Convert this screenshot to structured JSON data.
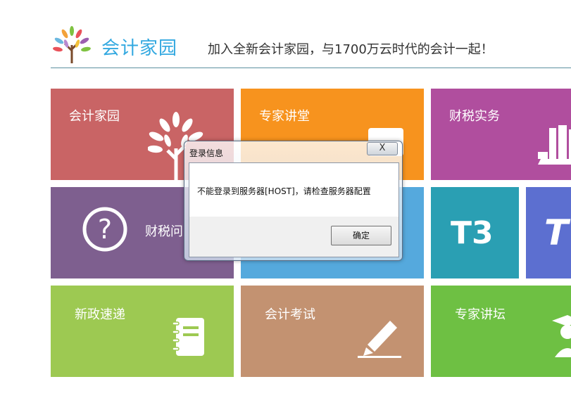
{
  "header": {
    "logo_text": "会计家园",
    "slogan": "加入全新会计家园，与1700万云时代的会计一起！"
  },
  "tiles": [
    {
      "label": "会计家园",
      "color": "#c96465",
      "icon": "tree-icon"
    },
    {
      "label": "专家讲堂",
      "color": "#f7931e",
      "icon": "monitor-icon"
    },
    {
      "label": "财税实务",
      "color": "#b04e9e",
      "icon": "books-icon"
    },
    {
      "label": "财税问",
      "color": "#7e5f8f",
      "icon": "question-icon"
    },
    {
      "label": "",
      "color": "#55a9dd",
      "icon": ""
    },
    {
      "label": "T3",
      "color": "#2a9fb3",
      "icon": "t3-icon"
    },
    {
      "label": "T",
      "color": "#5c6fd0",
      "icon": "t-icon"
    },
    {
      "label": "新政速递",
      "color": "#9dc952",
      "icon": "notebook-icon"
    },
    {
      "label": "会计考试",
      "color": "#c39271",
      "icon": "pen-icon"
    },
    {
      "label": "专家讲坛",
      "color": "#6ec043",
      "icon": "graduate-icon"
    }
  ],
  "dialog": {
    "title": "登录信息",
    "close_label": "X",
    "message": "不能登录到服务器[HOST]，请检查服务器配置",
    "ok_label": "确定"
  }
}
